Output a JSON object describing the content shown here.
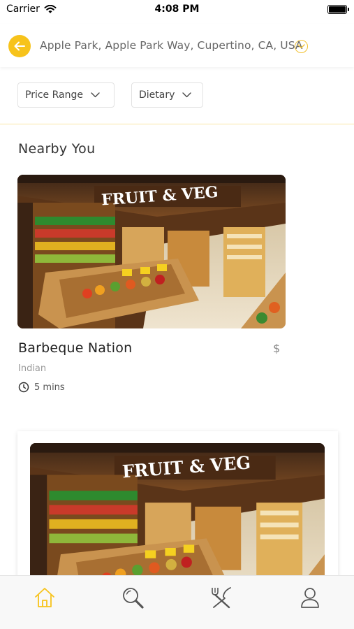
{
  "status_bar": {
    "carrier": "Carrier",
    "time": "4:08 PM"
  },
  "location": {
    "address": "Apple Park, Apple Park Way, Cupertino, CA, USA"
  },
  "filters": [
    {
      "label": "Price Range"
    },
    {
      "label": "Dietary"
    }
  ],
  "section": {
    "title": "Nearby You"
  },
  "restaurants": [
    {
      "name": "Barbeque Nation",
      "price": "$",
      "cuisine": "Indian",
      "time": "5 mins",
      "image_sign": "FRUIT & VEG"
    },
    {
      "image_sign": "FRUIT & VEG"
    }
  ],
  "tabs": [
    {
      "name": "home",
      "icon": "home-icon",
      "active": true
    },
    {
      "name": "search",
      "icon": "search-icon"
    },
    {
      "name": "restaurants",
      "icon": "fork-knife-icon"
    },
    {
      "name": "profile",
      "icon": "user-icon"
    }
  ],
  "colors": {
    "accent": "#f7c31b",
    "text": "#333333",
    "muted": "#999999"
  }
}
